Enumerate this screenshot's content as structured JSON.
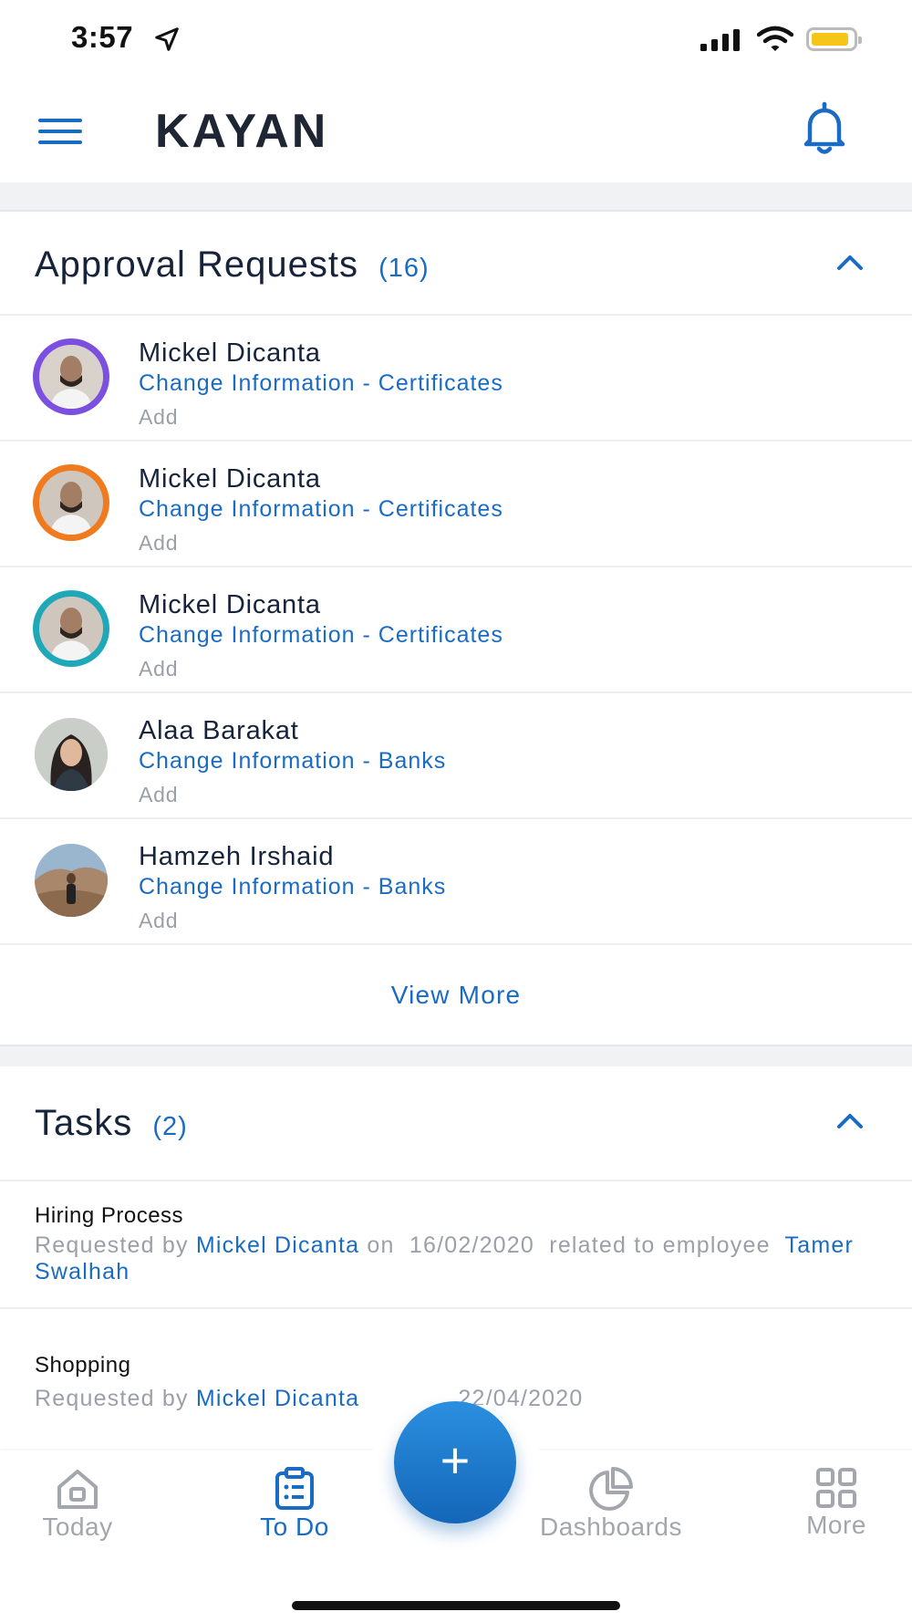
{
  "status_bar": {
    "time": "3:57"
  },
  "header": {
    "logo": "KAYAN"
  },
  "approvals": {
    "title": "Approval Requests",
    "count": "(16)",
    "items": [
      {
        "name": "Mickel Dicanta",
        "type": "Change Information - Certificates",
        "action": "Add",
        "ring_color": "#7b4fe0"
      },
      {
        "name": "Mickel Dicanta",
        "type": "Change Information - Certificates",
        "action": "Add",
        "ring_color": "#f07b1f"
      },
      {
        "name": "Mickel Dicanta",
        "type": "Change Information - Certificates",
        "action": "Add",
        "ring_color": "#1fa8b8"
      },
      {
        "name": "Alaa Barakat",
        "type": "Change Information - Banks",
        "action": "Add",
        "ring_color": "#ffffff"
      },
      {
        "name": "Hamzeh Irshaid",
        "type": "Change Information - Banks",
        "action": "Add",
        "ring_color": "#ffffff"
      }
    ],
    "view_more": "View More"
  },
  "tasks": {
    "title": "Tasks",
    "count": "(2)",
    "items": [
      {
        "title": "Hiring Process",
        "prefix": "Requested by",
        "requester": "Mickel Dicanta",
        "on": "on",
        "date": "16/02/2020",
        "related": "related to employee",
        "employee": "Tamer Swalhah"
      },
      {
        "title": "Shopping",
        "prefix": "Requested by",
        "requester": "Mickel Dicanta",
        "date_visible": "22/04/2020"
      }
    ]
  },
  "nav": {
    "today": "Today",
    "todo": "To Do",
    "dashboards": "Dashboards",
    "more": "More",
    "fab": "+"
  },
  "colors": {
    "accent": "#1a6bc4",
    "muted": "#9a9fa8",
    "title": "#17233a"
  }
}
